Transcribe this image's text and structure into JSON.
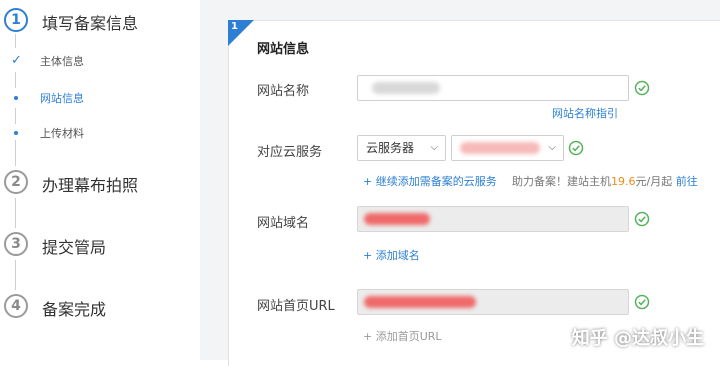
{
  "steps": [
    {
      "number": "1",
      "title": "填写备案信息"
    },
    {
      "number": "2",
      "title": "办理幕布拍照"
    },
    {
      "number": "3",
      "title": "提交管局"
    },
    {
      "number": "4",
      "title": "备案完成"
    }
  ],
  "substeps": [
    {
      "label": "主体信息",
      "state": "done"
    },
    {
      "label": "网站信息",
      "state": "current"
    },
    {
      "label": "上传材料",
      "state": "pending"
    }
  ],
  "card": {
    "corner_number": "1",
    "section_title": "网站信息"
  },
  "form": {
    "site_name": {
      "label": "网站名称",
      "value": "",
      "guide_link": "网站名称指引"
    },
    "cloud_service": {
      "label": "对应云服务",
      "type_value": "云服务器",
      "instance_value": "",
      "add_link": "+ 继续添加需备案的云服务",
      "promo_prefix": "助力备案！建站主机",
      "promo_price": "19.6",
      "promo_suffix": "元/月起",
      "promo_link": "前往"
    },
    "domain": {
      "label": "网站域名",
      "value": "",
      "add_link": "+ 添加域名"
    },
    "homepage_url": {
      "label": "网站首页URL",
      "value": "",
      "add_link": "+ 添加首页URL"
    }
  },
  "watermark": "知乎 @达叔小生",
  "colors": {
    "accent": "#2d7fd3",
    "success": "#52b35a",
    "price": "#f08c1a"
  },
  "icons": {
    "valid": "check-circle-icon",
    "done": "check-icon",
    "dropdown": "chevron-down-icon"
  }
}
